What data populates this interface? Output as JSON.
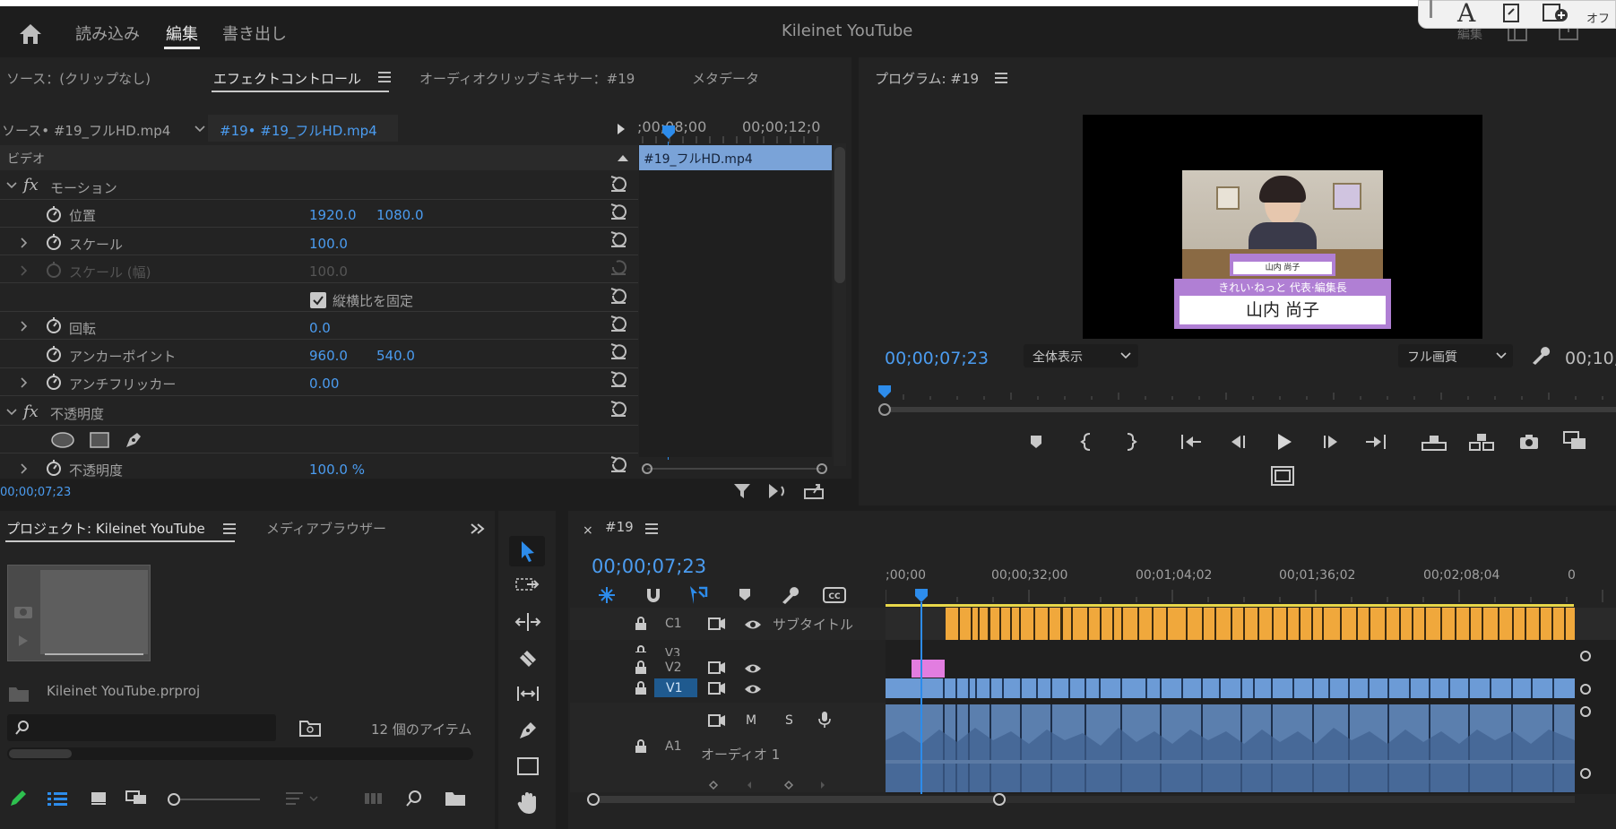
{
  "header": {
    "tabs": [
      "読み込み",
      "編集",
      "書き出し"
    ],
    "active_tab": "編集",
    "project_title": "Kileinet YouTube",
    "right_label": "編集",
    "far_right_label": "オフ"
  },
  "effect_panel": {
    "tabs": [
      "ソース：(クリップなし)",
      "エフェクトコントロール",
      "オーディオクリップミキサー：#19",
      "メタデータ"
    ],
    "source_label": "ソース• #19_フルHD.mp4",
    "sequence_label": "#19• #19_フルHD.mp4",
    "time_1": ";00;08;00",
    "time_2": "00;00;12;0",
    "clip_label": "#19_フルHD.mp4",
    "section_video": "ビデオ",
    "motion_label": "モーション",
    "position_label": "位置",
    "position_x": "1920.0",
    "position_y": "1080.0",
    "scale_label": "スケール",
    "scale_value": "100.0",
    "scale_width_label": "スケール (幅)",
    "scale_width_value": "100.0",
    "lock_ratio_label": "縦横比を固定",
    "rotation_label": "回転",
    "rotation_value": "0.0",
    "anchor_label": "アンカーポイント",
    "anchor_x": "960.0",
    "anchor_y": "540.0",
    "antiflicker_label": "アンチフリッカー",
    "antiflicker_value": "0.00",
    "opacity_section": "不透明度",
    "opacity_label": "不透明度",
    "opacity_value": "100.0 %",
    "timecode": "00;00;07;23"
  },
  "program": {
    "title": "プログラム: #19",
    "timecode": "00;00;07;23",
    "zoom": "全体表示",
    "quality": "フル画質",
    "duration": "00;10;",
    "caption_org": "きれい·ねっと 代表·編集長",
    "caption_name": "山内 尚子",
    "small_name": "山内 尚子"
  },
  "project": {
    "tabs": [
      "プロジェクト: Kileinet YouTube",
      "メディアブラウザー"
    ],
    "file_name": "Kileinet YouTube.prproj",
    "item_count": "12 個のアイテム",
    "search_placeholder": ""
  },
  "timeline": {
    "sequence": "#19",
    "timecode": "00;00;07;23",
    "ruler": [
      ";00;00",
      "00;00;32;00",
      "00;01;04;02",
      "00;01;36;02",
      "00;02;08;04",
      "0"
    ],
    "tracks": {
      "c1": "C1",
      "c1_name": "サブタイトル",
      "v3": "V3",
      "v2": "V2",
      "v1": "V1",
      "a1": "A1",
      "a1_name": "オーディオ 1",
      "m": "M",
      "s": "S"
    }
  },
  "colors": {
    "accent": "#2d8ceb",
    "caption_track": "#f0a83c",
    "video_clip": "#6c9bd6",
    "pink_clip": "#e27de0",
    "lavender": "#b07fd4"
  }
}
